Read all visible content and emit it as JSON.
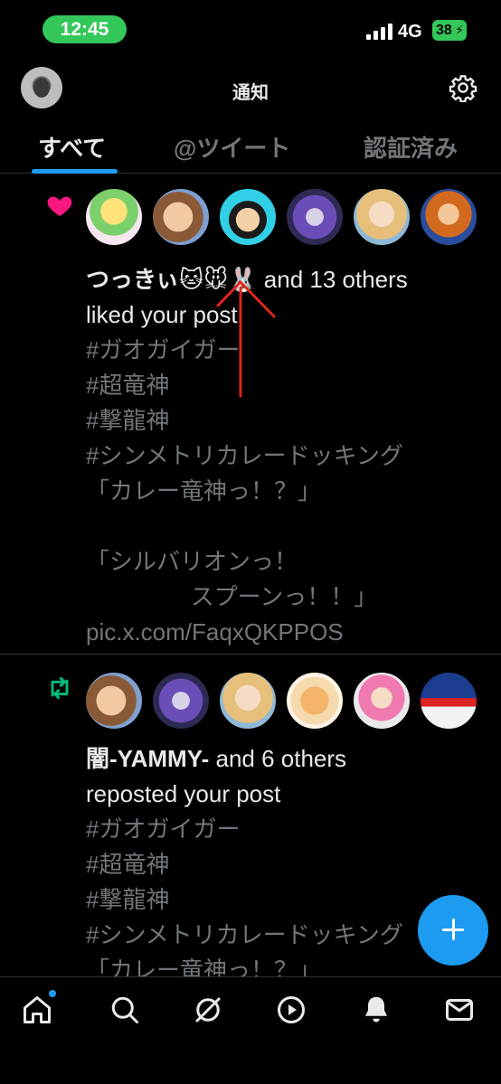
{
  "status_bar": {
    "time": "12:45",
    "network": "4G",
    "battery": "38"
  },
  "header": {
    "title": "通知"
  },
  "tabs": [
    {
      "label": "すべて",
      "active": true
    },
    {
      "label": "@ツイート",
      "active": false
    },
    {
      "label": "認証済み",
      "active": false
    }
  ],
  "notifications": [
    {
      "type": "like",
      "icon": "heart-icon",
      "icon_color": "#f91880",
      "actor": "つっきぃ🐱🐭🐰",
      "summary_suffix": " and 13 others",
      "action": "liked your post",
      "body": [
        "#ガオガイガー",
        "#超竜神",
        "#撃龍神",
        "#シンメトリカレードッキング",
        "「カレー竜神っ！？」",
        "",
        "「シルバリオンっ！",
        "                スプーンっ！！」",
        "pic.x.com/FaqxQKPPOS"
      ]
    },
    {
      "type": "repost",
      "icon": "repost-icon",
      "icon_color": "#00ba7c",
      "actor": "闇-YAMMY-",
      "summary_suffix": " and 6 others",
      "action": "reposted your post",
      "body": [
        "#ガオガイガー",
        "#超竜神",
        "#撃龍神",
        "#シンメトリカレードッキング",
        "「カレー竜神っ！？」"
      ]
    }
  ],
  "bottom_nav": [
    "home-icon",
    "search-icon",
    "grok-icon",
    "video-icon",
    "notifications-icon",
    "messages-icon"
  ],
  "colors": {
    "accent": "#1d9bf0",
    "background": "#000000",
    "secondary_text": "#71767b",
    "annotation": "#e0251b"
  }
}
